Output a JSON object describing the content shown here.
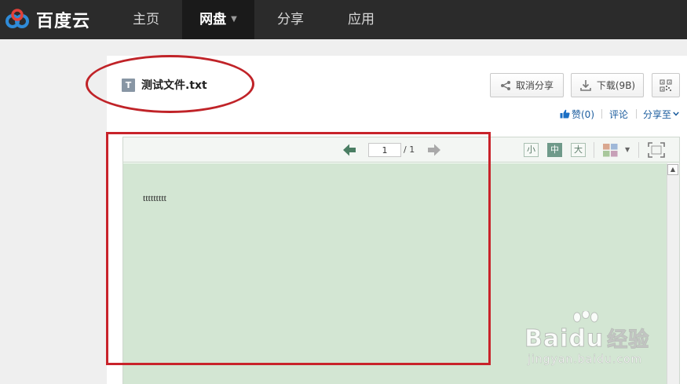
{
  "header": {
    "logo_text": "百度云",
    "nav": [
      {
        "label": "主页"
      },
      {
        "label": "网盘"
      },
      {
        "label": "分享"
      },
      {
        "label": "应用"
      }
    ]
  },
  "file": {
    "icon_letter": "T",
    "name": "测试文件.txt"
  },
  "actions": {
    "unshare_label": "取消分享",
    "download_label": "下载(9B)"
  },
  "social": {
    "like": "赞(0)",
    "comment": "评论",
    "share_to": "分享至"
  },
  "viewer": {
    "page_current": "1",
    "page_total": "/ 1",
    "size_small": "小",
    "size_mid": "中",
    "size_large": "大",
    "content": "ttttttttt"
  },
  "watermark": {
    "main": "Baidu",
    "cn": "经验",
    "url": "jingyan.baidu.com"
  },
  "colors": {
    "topbar": "#2b2b2b",
    "doc_background": "#d3e6d3",
    "annotation": "#c02328",
    "link": "#1b5c9e"
  }
}
